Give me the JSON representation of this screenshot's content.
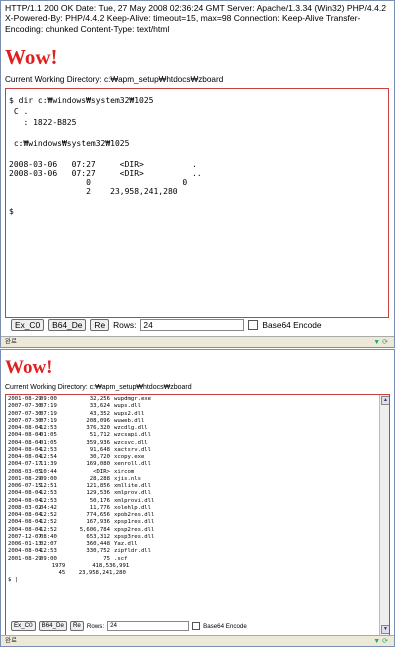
{
  "shot1": {
    "headers": "HTTP/1.1 200 OK Date: Tue, 27 May 2008 02:36:24 GMT Server: Apache/1.3.34 (Win32) PHP/4.4.2 X-Powered-By: PHP/4.4.2 Keep-Alive: timeout=15, max=98 Connection: Keep-Alive Transfer-Encoding: chunked Content-Type: text/html",
    "title": "Wow!",
    "cwd": "Current Working Directory: c:₩apm_setup₩htdocs₩zboard",
    "terminal_lines": [
      "$ dir c:₩windows₩system32₩1025",
      " C .",
      "   : 1822-B825",
      "",
      " c:₩windows₩system32₩1025",
      "",
      "2008-03-06   07:27     <DIR>          .",
      "2008-03-06   07:27     <DIR>          ..",
      "                0                   0",
      "                2    23,958,241,280",
      "",
      "$"
    ],
    "buttons": [
      "Ex_C0",
      "B64_De",
      "Re"
    ],
    "rows_label": "Rows:",
    "rows_value": "24",
    "checkbox_label": "Base64 Encode",
    "status_text": "완료"
  },
  "shot2": {
    "title": "Wow!",
    "cwd": "Current Working Directory: c:₩apm_setup₩htdocs₩zboard",
    "listing": [
      {
        "date": "2001-08-29",
        "time": "09:00",
        "size": "32,256",
        "name": "wupdmgr.exe"
      },
      {
        "date": "2007-07-30",
        "time": "07:19",
        "size": "33,624",
        "name": "wups.dll"
      },
      {
        "date": "2007-07-30",
        "time": "07:19",
        "size": "43,352",
        "name": "wups2.dll"
      },
      {
        "date": "2007-07-30",
        "time": "07:19",
        "size": "208,096",
        "name": "wuweb.dll"
      },
      {
        "date": "2004-08-04",
        "time": "12:53",
        "size": "376,320",
        "name": "wzcdlg.dll"
      },
      {
        "date": "2004-08-04",
        "time": "01:05",
        "size": "51,712",
        "name": "wzcsapi.dll"
      },
      {
        "date": "2004-08-04",
        "time": "01:05",
        "size": "359,936",
        "name": "wzcsvc.dll"
      },
      {
        "date": "2004-08-04",
        "time": "12:53",
        "size": "91,648",
        "name": "xactsrv.dll"
      },
      {
        "date": "2004-08-04",
        "time": "12:54",
        "size": "30,720",
        "name": "xcopy.exe"
      },
      {
        "date": "2004-07-17",
        "time": "11:39",
        "size": "169,080",
        "name": "xenroll.dll"
      },
      {
        "date": "2008-03-05",
        "time": "10:44",
        "size": "<DIR>",
        "name": "xircom"
      },
      {
        "date": "2001-08-29",
        "time": "09:00",
        "size": "28,288",
        "name": "xjis.nls"
      },
      {
        "date": "2006-07-15",
        "time": "12:51",
        "size": "121,856",
        "name": "xmllite.dll"
      },
      {
        "date": "2004-08-04",
        "time": "12:53",
        "size": "129,536",
        "name": "xmlprov.dll"
      },
      {
        "date": "2004-08-04",
        "time": "12:53",
        "size": "50,176",
        "name": "xmlprovi.dll"
      },
      {
        "date": "2008-03-02",
        "time": "04:42",
        "size": "11,776",
        "name": "xolehlp.dll"
      },
      {
        "date": "2004-08-04",
        "time": "12:52",
        "size": "774,656",
        "name": "xpob2res.dll"
      },
      {
        "date": "2004-08-04",
        "time": "12:52",
        "size": "167,936",
        "name": "xpsp1res.dll"
      },
      {
        "date": "2004-08-04",
        "time": "12:52",
        "size": "5,606,784",
        "name": "xpsp2res.dll"
      },
      {
        "date": "2007-12-07",
        "time": "08:40",
        "size": "653,312",
        "name": "xpsp3res.dll"
      },
      {
        "date": "2006-01-13",
        "time": "02:07",
        "size": "360,448",
        "name": "Yaz.dll"
      },
      {
        "date": "2004-08-04",
        "time": "12:53",
        "size": "330,752",
        "name": "zipfldr.dll"
      },
      {
        "date": "2001-08-29",
        "time": "09:00",
        "size": "75",
        "name": ".scf"
      }
    ],
    "summary_lines": [
      "             1979        418,536,991",
      "               45    23,958,241,280",
      "$ |"
    ],
    "buttons": [
      "Ex_C0",
      "B64_De",
      "Re"
    ],
    "rows_label": "Rows:",
    "rows_value": "24",
    "checkbox_label": "Base64 Encode",
    "status_text": "완료"
  }
}
